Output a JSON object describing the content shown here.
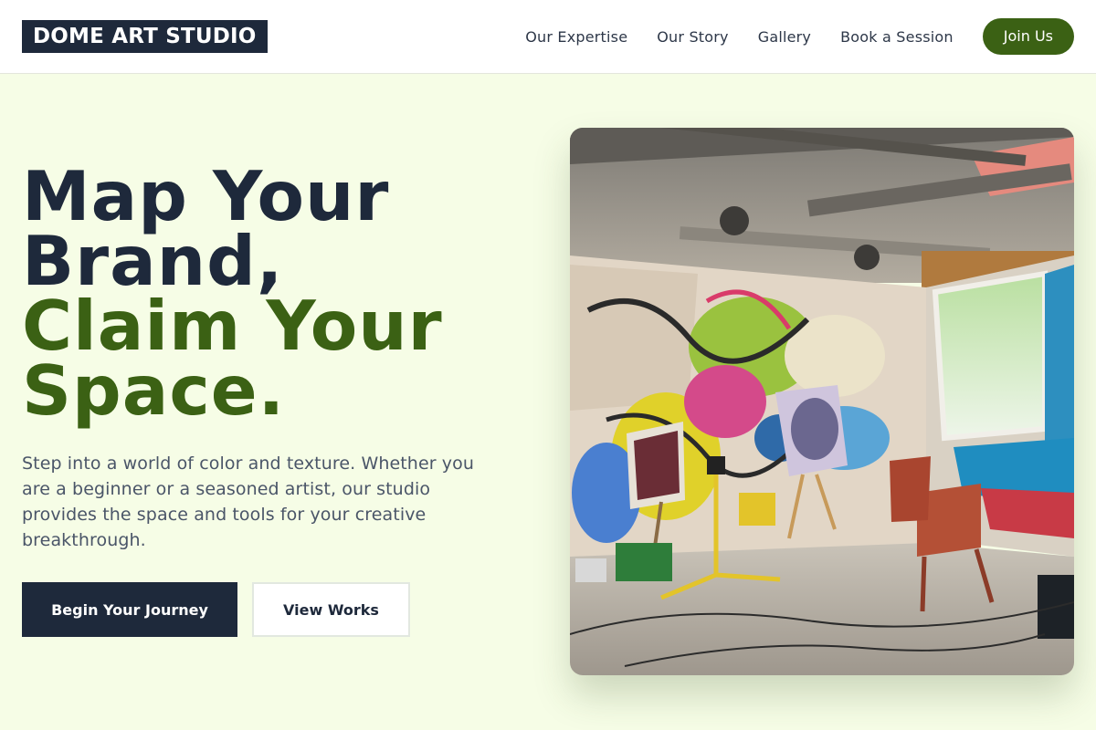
{
  "header": {
    "logo": "DOME ART STUDIO",
    "nav": [
      "Our Expertise",
      "Our Story",
      "Gallery",
      "Book a Session"
    ],
    "cta": "Join Us"
  },
  "hero": {
    "heading_dark_1": "Map Your",
    "heading_dark_2": "Brand,",
    "heading_green_1": "Claim Your",
    "heading_green_2": "Space.",
    "description": "Step into a world of color and texture. Whether you are a beginner or a seasoned artist, our studio provides the space and tools for your creative breakthrough.",
    "primary_button": "Begin Your Journey",
    "secondary_button": "View Works",
    "image_subject": "graffiti-art-studio-photo"
  },
  "colors": {
    "navy": "#1e293b",
    "green": "#3b6114",
    "background": "#f6fde6"
  }
}
